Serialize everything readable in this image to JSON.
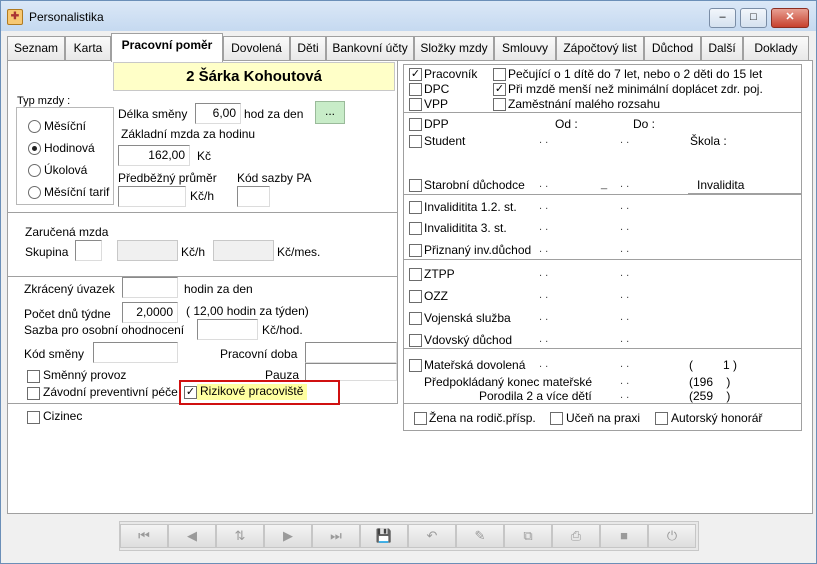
{
  "window": {
    "title": "Personalistika",
    "min": "–",
    "max": "□",
    "close": "✕"
  },
  "tabs": [
    "Seznam",
    "Karta",
    "Pracovní poměr",
    "Dovolená",
    "Děti",
    "Bankovní účty",
    "Složky mzdy",
    "Smlouvy",
    "Zápočtový list",
    "Důchod",
    "Další",
    "Doklady"
  ],
  "active_tab": "Pracovní poměr",
  "employee_name": "2 Šárka Kohoutová",
  "typ_mzdy": {
    "legend": "Typ mzdy :",
    "options": [
      "Měsíční",
      "Hodinová",
      "Úkolová",
      "Měsíční tarif"
    ],
    "selected": "Hodinová"
  },
  "delka_smeny": {
    "label": "Délka směny",
    "value": "6,00",
    "unit": "hod za den",
    "btn": "..."
  },
  "zakladni_mzda": {
    "label": "Základní mzda za hodinu",
    "value": "162,00",
    "unit": "Kč"
  },
  "predbezny_prumer": {
    "label": "Předběžný průměr",
    "unit": "Kč/h",
    "value": ""
  },
  "kod_sazby": {
    "label": "Kód sazby PA",
    "value": ""
  },
  "zarucena": {
    "label": "Zaručená mzda",
    "skupina": "Skupina",
    "unit_h": "Kč/h",
    "unit_mes": "Kč/mes."
  },
  "zkraceny": {
    "label": "Zkrácený úvazek",
    "unit": "hodin za den",
    "value": ""
  },
  "pocet_dnu": {
    "label": "Počet dnů  týdne",
    "value": "2,0000",
    "note": "( 12,00 hodin za týden)"
  },
  "sazba_oon": {
    "label": "Sazba pro osobní ohodnocení",
    "unit": "Kč/hod.",
    "value": ""
  },
  "kod_smeny": {
    "label": "Kód směny",
    "value": ""
  },
  "pracovni_doba": {
    "label": "Pracovní doba",
    "pauza": "Pauza"
  },
  "checks_left": {
    "smenny": "Směnný provoz",
    "zavodni": "Závodní preventivní péče",
    "rizikove": "Rizikové pracoviště",
    "cizinec": "Cizinec"
  },
  "right": {
    "pracovnik": "Pracovník",
    "dpc": "DPC",
    "vpp": "VPP",
    "pecujici": "Pečující o 1 dítě do 7 let, nebo o 2 děti do 15 let",
    "pri_mzde": "Při mzdě menší než minimální doplácet zdr. poj.",
    "zamestnani": "Zaměstnání malého rozsahu",
    "dpp": "DPP",
    "od": "Od :",
    "do": "Do :",
    "student": "Student",
    "skola": "Škola :",
    "starobni": "Starobní důchodce",
    "invalidita": "Invalidita",
    "inv12": "Invaliditita 1.2. st.",
    "inv3": "Invaliditita 3. st.",
    "priznany": "Přiznaný inv.důchod",
    "ztpp": "ZTPP",
    "ozz": "OZZ",
    "vojenska": "Vojenská služba",
    "vdovsky": "Vdovský důchod",
    "materska": "Mateřská dovolená",
    "materska_val": "(         1 )",
    "predpokladany": "Předpokládaný konec mateřské",
    "predpokladany_val": "(196    )",
    "porodila": "Porodila 2 a více dětí",
    "porodila_val": "(259    )",
    "zena": "Žena na rodič.přísp.",
    "ucen": "Učeň na praxi",
    "autorsky": "Autorský honorář",
    "dot": ". .",
    "dash": "_"
  },
  "nav": {
    "first": "⏮",
    "prev": "◀",
    "sort": "⇅",
    "next": "▶",
    "last": "⏭",
    "save": "💾",
    "undo": "↶",
    "del": "✎",
    "copy": "⧉",
    "print": "⎙",
    "stop": "■",
    "power": "⏻"
  }
}
